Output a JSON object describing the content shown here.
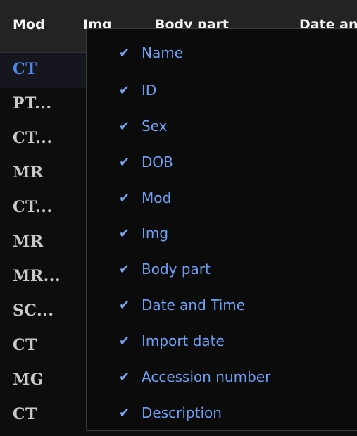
{
  "table": {
    "headers": [
      "Mod",
      "Img",
      "Body part",
      "Date an"
    ],
    "rows": [
      "CT",
      "PT...",
      "CT...",
      "MR",
      "CT...",
      "MR",
      "MR...",
      "SC...",
      "CT",
      "MG",
      "CT"
    ],
    "selected_row": 0
  },
  "column_menu": {
    "check_glyph": "✔",
    "items": [
      "Name",
      "ID",
      "Sex",
      "DOB",
      "Mod",
      "Img",
      "Body part",
      "Date and Time",
      "Import date",
      "Accession number",
      "Description"
    ]
  }
}
